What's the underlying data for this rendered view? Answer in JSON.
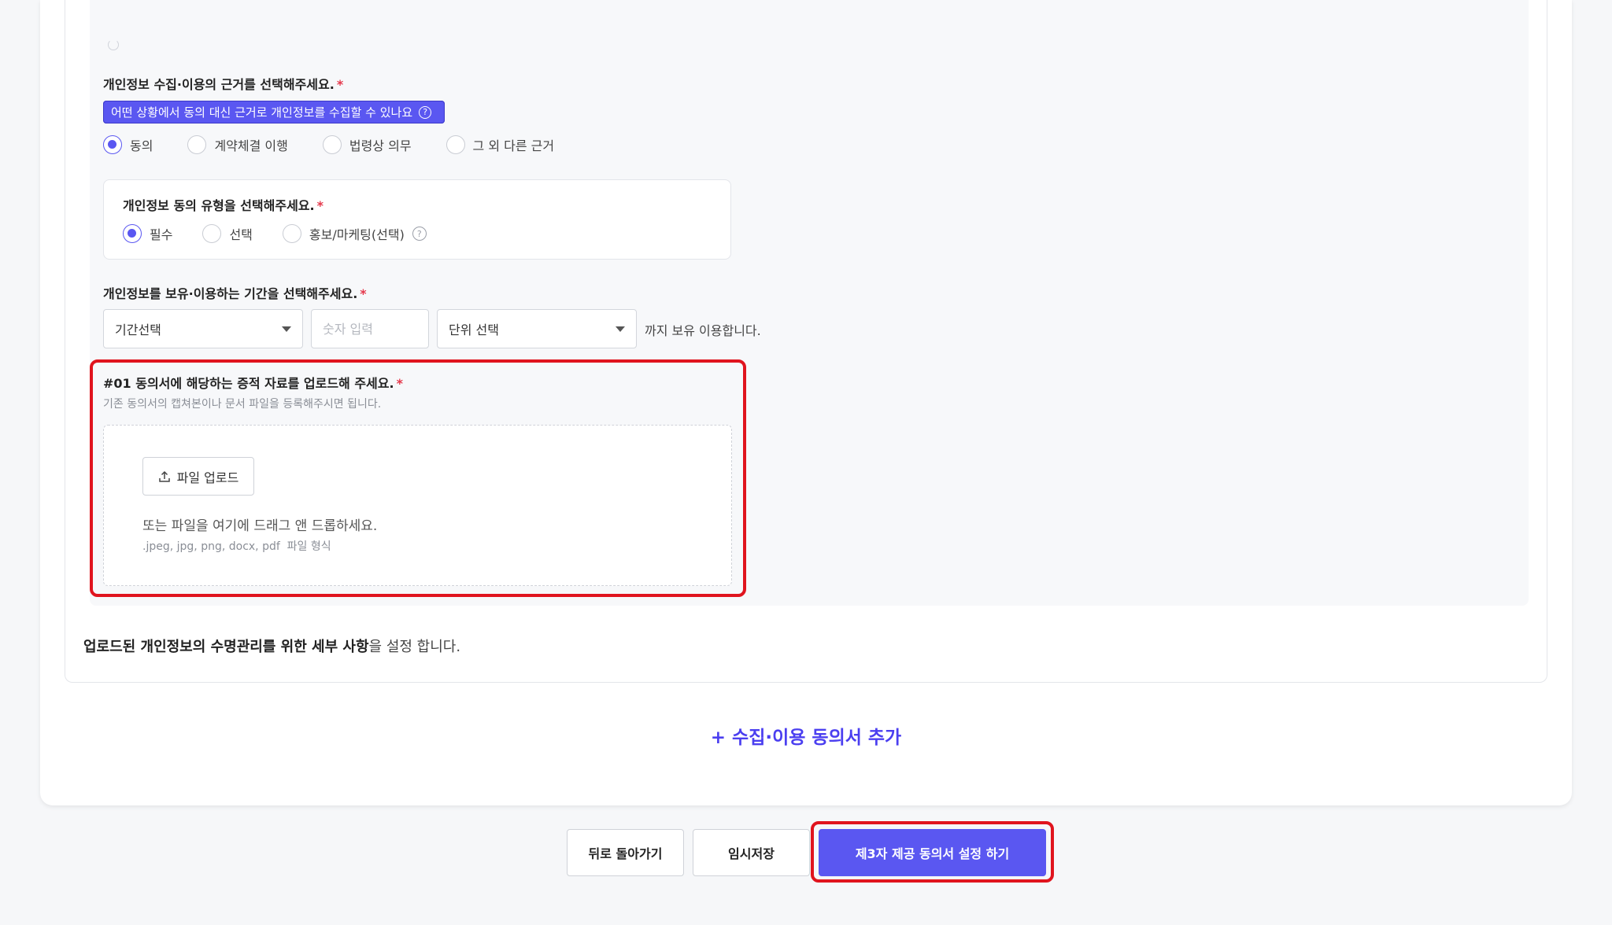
{
  "basis": {
    "label": "개인정보 수집·이용의 근거를 선택해주세요.",
    "required_mark": "*",
    "help_chip": "어떤 상황에서 동의 대신 근거로 개인정보를 수집할 수 있나요",
    "help_icon": "?",
    "options": [
      "동의",
      "계약체결 이행",
      "법령상 의무",
      "그 외 다른 근거"
    ],
    "selected": "동의"
  },
  "consent_type": {
    "label": "개인정보 동의 유형을 선택해주세요.",
    "required_mark": "*",
    "options": [
      "필수",
      "선택",
      "홍보/마케팅(선택)"
    ],
    "selected": "필수",
    "help_icon": "?"
  },
  "retention": {
    "label": "개인정보를 보유·이용하는 기간을 선택해주세요.",
    "required_mark": "*",
    "period_select": "기간선택",
    "number_placeholder": "숫자 입력",
    "unit_select": "단위 선택",
    "suffix": "까지 보유 이용합니다."
  },
  "upload": {
    "label": "#01 동의서에 해당하는 증적 자료를 업로드해 주세요.",
    "required_mark": "*",
    "sublabel": "기존 동의서의 캡쳐본이나 문서 파일을 등록해주시면 됩니다.",
    "button": "파일 업로드",
    "drag_text": "또는 파일을 여기에 드래그 앤 드롭하세요.",
    "formats": ".jpeg, jpg, png, docx, pdf  파일 형식"
  },
  "lifecycle": {
    "bold_text": "업로드된 개인정보의 수명관리를 위한 세부 사항",
    "rest_text": "을 설정 합니다."
  },
  "add_consent": "+ 수집·이용 동의서 추가",
  "footer": {
    "back": "뒤로 돌아가기",
    "save_draft": "임시저장",
    "next": "제3자 제공 동의서 설정 하기"
  },
  "colors": {
    "accent": "#5a57f1",
    "highlight_frame": "#e0141e",
    "required": "#e5384b"
  }
}
